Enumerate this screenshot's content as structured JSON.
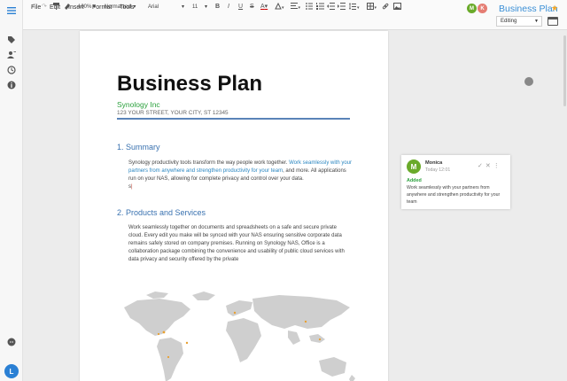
{
  "menu": {
    "file": "File",
    "edit": "Edit",
    "insert": "Insert",
    "format": "Format",
    "tools": "Tools"
  },
  "doc": {
    "title": "Business Plan"
  },
  "users": {
    "m": "M",
    "k": "K",
    "current": "L"
  },
  "toolbar": {
    "zoom": "100%",
    "style": "Normal text",
    "font": "Arial",
    "size": "11",
    "bold": "B",
    "italic": "I",
    "underline": "U",
    "strike": "S",
    "text_color": "A",
    "mode": "Editing"
  },
  "document": {
    "heading": "Business Plan",
    "company": "Synology Inc",
    "address": "123 YOUR STREET, YOUR CITY, ST 12345",
    "section1": {
      "title": "1. Summary",
      "text_a": "Synology productivity tools transform the way people work together. ",
      "text_highlight": "Work seamlessly with your partners from anywhere and strengthen productivity for your team",
      "text_b": ", and more. All applications run on your NAS, allowing for complete privacy and control over your data.",
      "text_c": "s"
    },
    "section2": {
      "title": "2. Products and Services",
      "text": "Work seamlessly together on documents and spreadsheets on a safe and secure private cloud. Every edit you make will be synced with your NAS ensuring sensitive corporate data remains safely stored on company premises. Running on Synology NAS, Office is a collaboration package combining the convenience and usability of public cloud services with data privacy and security offered by the private"
    }
  },
  "comment": {
    "avatar": "M",
    "author": "Monica",
    "time": "Today 12:01",
    "status": "Added",
    "text": "Work seamlessly with your partners from anywhere and strengthen productivity for your team"
  },
  "colors": {
    "accent": "#3a8fd6",
    "heading_blue": "#3a72b0",
    "green": "#2aa03c",
    "star": "#f5a623"
  },
  "icons": [
    "menu-icon",
    "tag-icon",
    "add-user-icon",
    "history-icon",
    "info-icon",
    "chat-icon",
    "undo-icon",
    "redo-icon",
    "paint-format-icon",
    "clear-format-icon",
    "link-icon",
    "table-icon",
    "image-icon",
    "star-icon"
  ]
}
